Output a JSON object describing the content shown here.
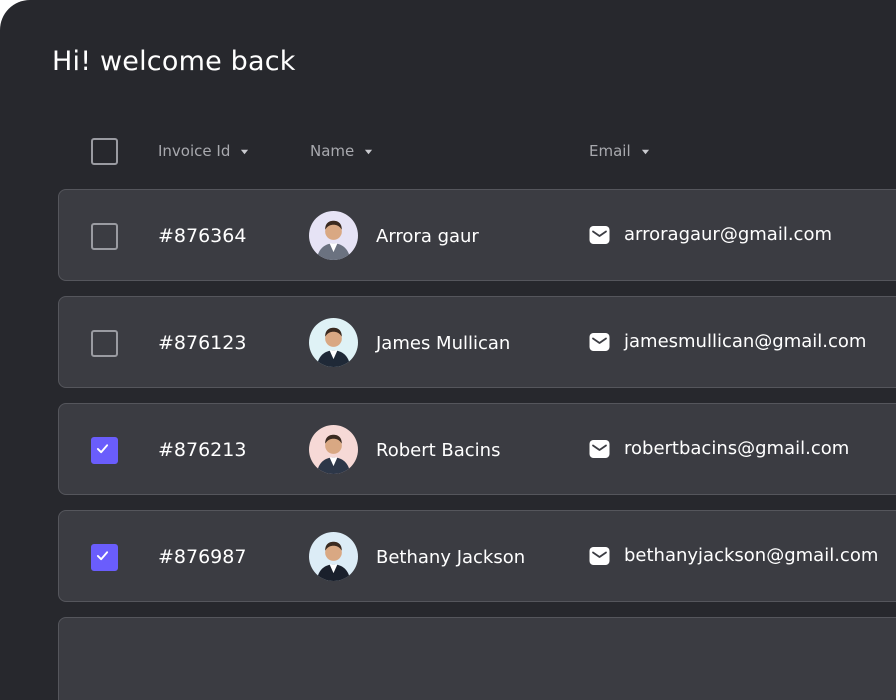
{
  "page": {
    "title": "Hi! welcome back"
  },
  "table": {
    "header_checked": false,
    "columns": [
      {
        "label": "Invoice Id",
        "icon": "sort-caret-icon"
      },
      {
        "label": "Name",
        "icon": "sort-caret-icon"
      },
      {
        "label": "Email",
        "icon": "sort-caret-icon"
      }
    ],
    "rows": [
      {
        "checked": false,
        "invoice": "#876364",
        "name": "Arrora gaur",
        "email": "arroragaur@gmail.com",
        "avatar_bg": "#e6e3f5",
        "avatar_suit": "#6b7280"
      },
      {
        "checked": false,
        "invoice": "#876123",
        "name": "James Mullican",
        "email": "jamesmullican@gmail.com",
        "avatar_bg": "#dff2f6",
        "avatar_suit": "#1f2937"
      },
      {
        "checked": true,
        "invoice": "#876213",
        "name": "Robert Bacins",
        "email": "robertbacins@gmail.com",
        "avatar_bg": "#f6d9d6",
        "avatar_suit": "#2d3748"
      },
      {
        "checked": true,
        "invoice": "#876987",
        "name": "Bethany Jackson",
        "email": "bethanyjackson@gmail.com",
        "avatar_bg": "#dcecf6",
        "avatar_suit": "#1a202c"
      }
    ]
  },
  "colors": {
    "panel_bg": "#27282d",
    "row_bg": "#3b3c42",
    "row_border": "#55565c",
    "accent": "#6a5dfc",
    "text": "#ffffff",
    "muted_text": "#a8a9ae"
  }
}
